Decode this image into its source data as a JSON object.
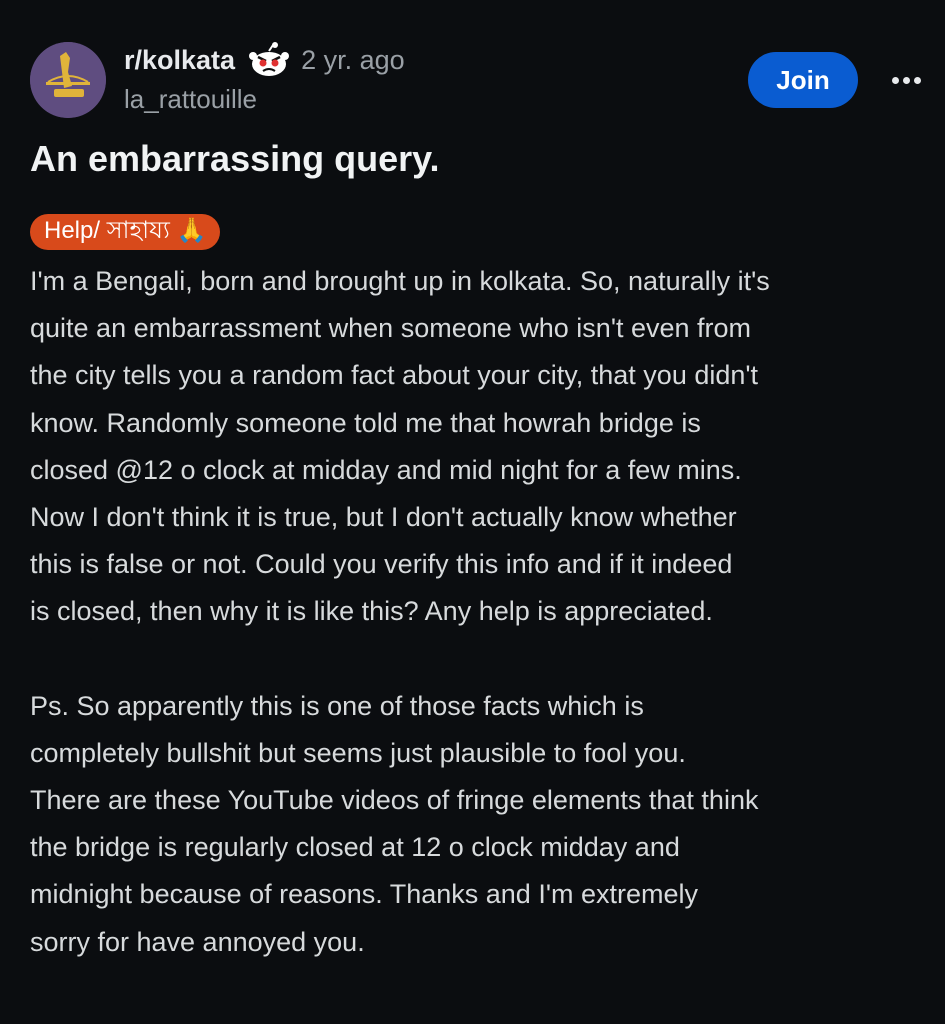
{
  "post": {
    "subreddit": "r/kolkata",
    "age": "2 yr. ago",
    "username": "la_rattouille",
    "join_label": "Join",
    "title": "An embarrassing query.",
    "flair": "Help/ সাহায্য 🙏",
    "body_paragraphs": [
      "I'm a Bengali, born and brought up in kolkata. So, naturally it's\nquite an embarrassment when someone who isn't even from\nthe city tells you a random fact about your city, that you didn't\nknow. Randomly someone told me that howrah bridge is\nclosed @12 o clock at midday and mid night for a few mins.\nNow I don't think it is true, but I don't actually know whether\nthis is false or not. Could you verify this info and if it indeed\nis closed, then why it is like this? Any help is appreciated.",
      "Ps. So apparently this is one of those facts which is\ncompletely bullshit but seems just plausible to fool you.\nThere are these YouTube videos of fringe elements that think\nthe bridge is regularly closed at 12 o clock midday and\nmidnight because of reasons. Thanks and I'm extremely\nsorry for have annoyed you."
    ]
  },
  "icons": {
    "avatar": "subreddit-avatar",
    "badge": "angry-snoo-icon",
    "more": "more-options-icon"
  },
  "colors": {
    "background": "#0b0d10",
    "join_button": "#0a5cd1",
    "flair": "#d84a1b",
    "text": "#d7dadc"
  }
}
